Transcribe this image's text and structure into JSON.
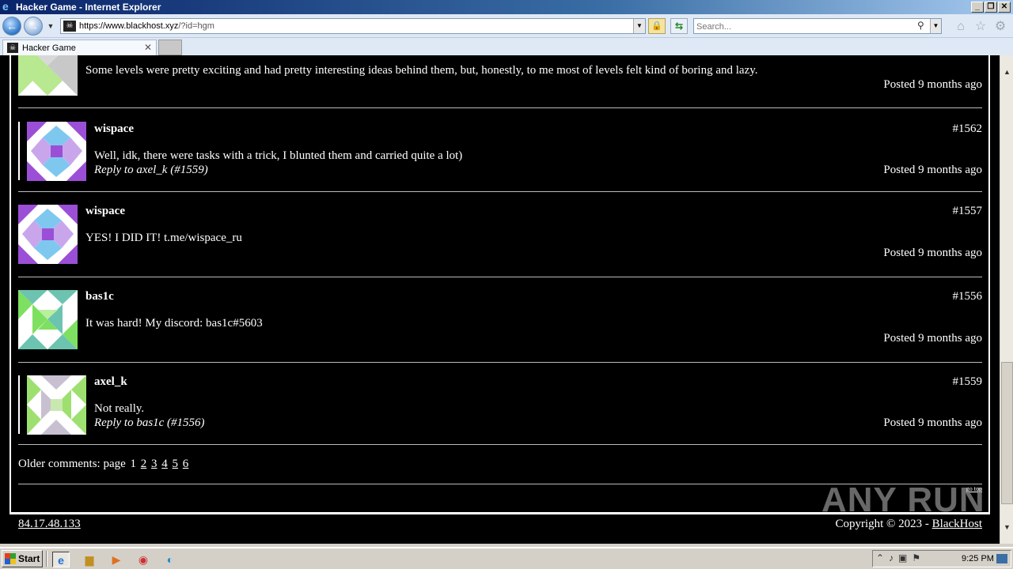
{
  "window": {
    "title": "Hacker Game - Internet Explorer",
    "minimize": "_",
    "restore": "❐",
    "close": "✕"
  },
  "address_bar": {
    "url_host": "https://www.blackhost.xyz",
    "url_path": "/?id=hgm",
    "search_placeholder": "Search..."
  },
  "tabs": [
    {
      "label": "Hacker Game"
    }
  ],
  "comments": [
    {
      "text": "Some levels were pretty exciting and had pretty interesting ideas behind them, but, honestly, to me most of levels felt kind of boring and lazy.",
      "posted": "Posted 9 months ago",
      "avatar_colors": [
        "#b8e890",
        "#c8c8c8"
      ]
    },
    {
      "author": "wispace",
      "number": "#1562",
      "text": "Well, idk, there were tasks with a trick, I blunted them and carried quite a lot)",
      "reply": "Reply to axel_k (#1559)",
      "posted": "Posted 9 months ago",
      "avatar_colors": [
        "#9b4fd6",
        "#7ec8f0"
      ]
    },
    {
      "author": "wispace",
      "number": "#1557",
      "text": "YES! I DID IT! t.me/wispace_ru",
      "posted": "Posted 9 months ago",
      "avatar_colors": [
        "#9b4fd6",
        "#7ec8f0"
      ]
    },
    {
      "author": "bas1c",
      "number": "#1556",
      "text": "It was hard! My discord: bas1c#5603",
      "posted": "Posted 9 months ago",
      "avatar_colors": [
        "#7ee060",
        "#6cc4b0"
      ]
    },
    {
      "author": "axel_k",
      "number": "#1559",
      "text": "Not really.",
      "reply": "Reply to bas1c (#1556)",
      "posted": "Posted 9 months ago",
      "avatar_colors": [
        "#9ee070",
        "#c8c0d0"
      ]
    }
  ],
  "pagination": {
    "label": "Older comments: page",
    "current": "1",
    "pages": [
      "2",
      "3",
      "4",
      "5",
      "6"
    ]
  },
  "go_top": "go top",
  "footer": {
    "ip": "84.17.48.133",
    "copyright": "Copyright © 2023 - ",
    "brand": "BlackHost"
  },
  "watermark": "ANY RUN",
  "taskbar": {
    "start": "Start",
    "clock": "9:25 PM"
  }
}
